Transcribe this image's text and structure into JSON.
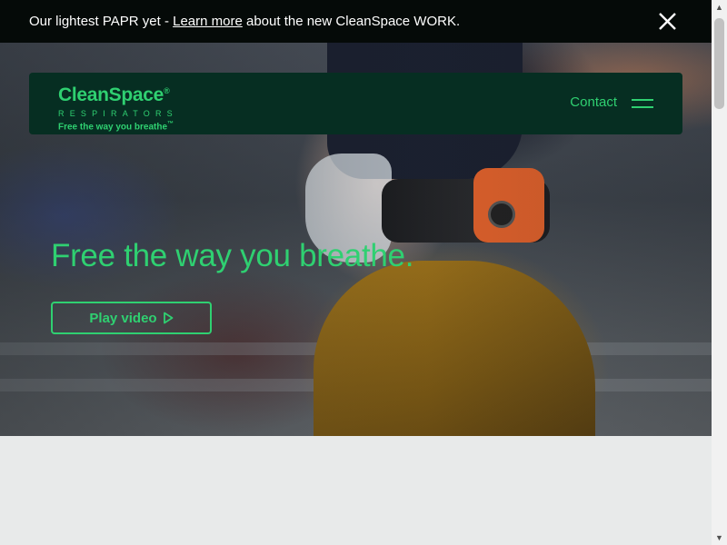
{
  "announcement": {
    "prefix": "Our lightest PAPR yet - ",
    "link_text": "Learn more",
    "suffix": " about the new CleanSpace WORK.",
    "close_icon": "close-icon"
  },
  "nav": {
    "logo": {
      "wordmark": "CleanSpace",
      "registered_mark": "®",
      "subtitle": "RESPIRATORS",
      "tagline": "Free the way you breathe",
      "tagline_mark": "™"
    },
    "contact_label": "Contact",
    "menu_icon": "hamburger-menu-icon"
  },
  "hero": {
    "headline": "Free the way you breathe.",
    "play_button_label": "Play video",
    "play_icon": "play-icon",
    "image_subject": "Worker wearing a CleanSpace respirator in a welding jacket"
  },
  "colors": {
    "brand_green": "#2fd071",
    "nav_background": "#062e22",
    "announcement_background": "#050a08",
    "page_background": "#e8eaea"
  }
}
